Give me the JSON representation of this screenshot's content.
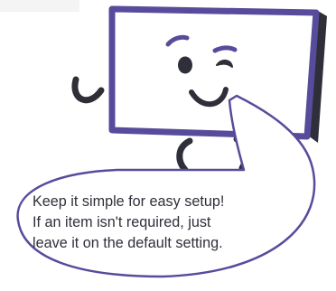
{
  "tip": {
    "lines": [
      "Keep it simple for easy setup!",
      "If an item isn't required, just",
      "leave it on the default setting."
    ]
  },
  "colors": {
    "outline": "#574c9b",
    "screen": "#ffffff",
    "monitor_side": "#2f2f3a",
    "text": "#2f2f3a"
  }
}
